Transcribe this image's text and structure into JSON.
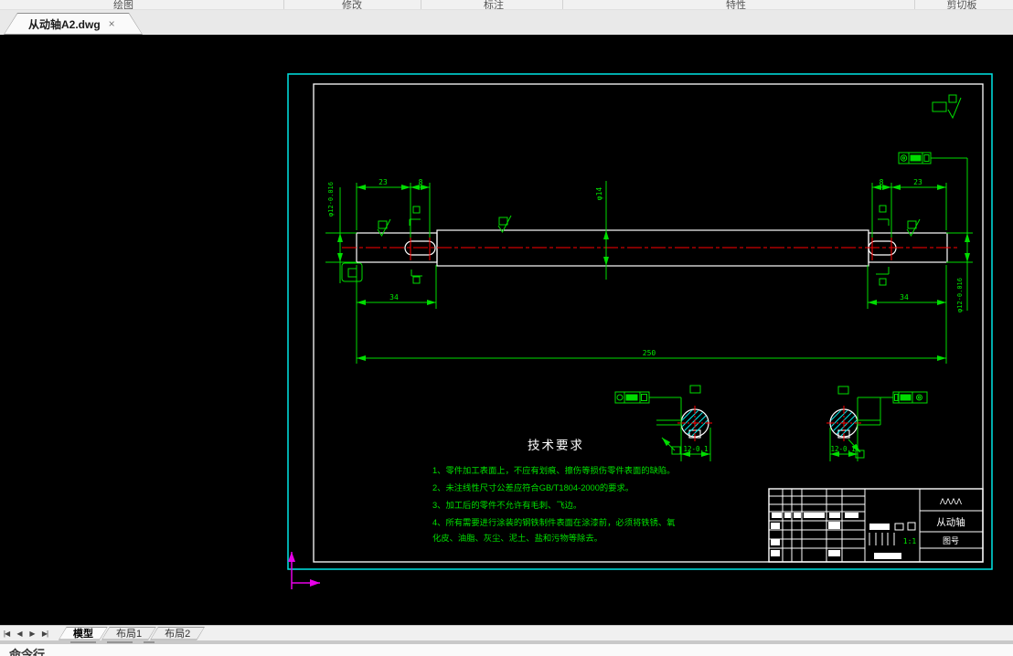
{
  "ribbon": {
    "panels": [
      "绘图",
      "修改",
      "标注",
      "特性",
      "剪切板"
    ]
  },
  "doc_tab": {
    "title": "从动轴A2.dwg",
    "close_icon": "×"
  },
  "layout_bar": {
    "nav_icons": [
      "|◀",
      "◀",
      "▶",
      "▶|"
    ],
    "tabs": [
      "模型",
      "布局1",
      "布局2"
    ],
    "active_tab": "模型"
  },
  "command_line": {
    "label": "命令行"
  },
  "drawing": {
    "dimensions": {
      "left_outer": "23",
      "left_inner": "8",
      "right_inner": "8",
      "right_outer": "23",
      "left_seg": "34",
      "right_seg": "34",
      "total_length": "250",
      "mid_diameter": "φ14",
      "left_diameter": "φ12-0.016",
      "right_diameter": "φ12-0.016",
      "left_section": "12-0.1",
      "right_section": "12-0.1"
    },
    "tech_requirements": {
      "title": "技术要求",
      "lines": [
        "1、零件加工表面上，不应有划痕、擦伤等损伤零件表面的缺陷。",
        "2、未注线性尺寸公差应符合GB/T1804-2000的要求。",
        "3、加工后的零件不允许有毛刺、飞边。",
        "4、所有需要进行涂装的钢铁制件表面在涂漆前，必须将铁锈、氧",
        "化皮、油脂、灰尘、泥土、盐和污物等除去。"
      ]
    },
    "title_block": {
      "company": "ΛΛΛΛ",
      "part_name": "从动轴",
      "drawing_no": "图号",
      "scale": "1:1"
    },
    "colors": {
      "dimension": "#00dd00",
      "centerline": "#ff0000",
      "outline": "#ffffff",
      "border": "#00e5e5",
      "ucs": "#e800e8"
    }
  }
}
